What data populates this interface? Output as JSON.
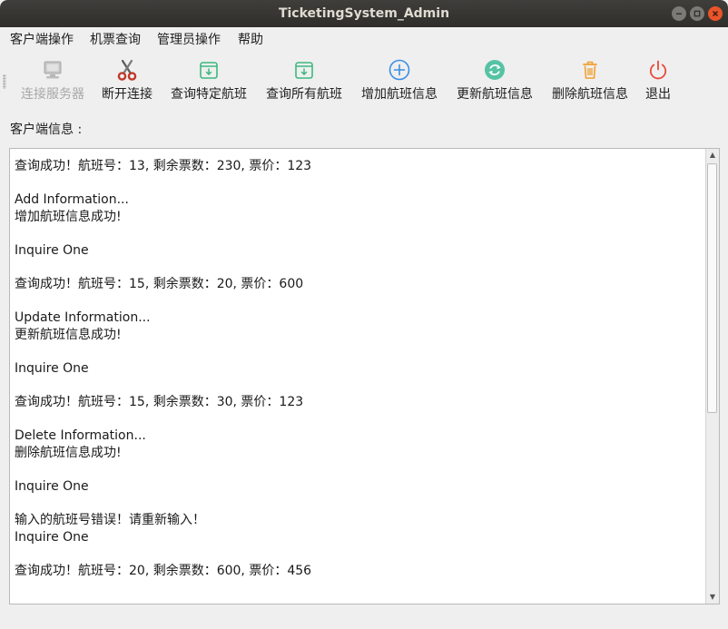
{
  "window": {
    "title": "TicketingSystem_Admin"
  },
  "menubar": {
    "items": [
      {
        "label": "客户端操作"
      },
      {
        "label": "机票查询"
      },
      {
        "label": "管理员操作"
      },
      {
        "label": "帮助"
      }
    ]
  },
  "toolbar": {
    "items": [
      {
        "label": "连接服务器",
        "icon": "server-icon",
        "enabled": false
      },
      {
        "label": "断开连接",
        "icon": "scissors-icon",
        "enabled": true
      },
      {
        "label": "查询特定航班",
        "icon": "archive-down-icon",
        "enabled": true
      },
      {
        "label": "查询所有航班",
        "icon": "archive-down-icon",
        "enabled": true
      },
      {
        "label": "增加航班信息",
        "icon": "add-circle-icon",
        "enabled": true
      },
      {
        "label": "更新航班信息",
        "icon": "refresh-icon",
        "enabled": true
      },
      {
        "label": "删除航班信息",
        "icon": "trash-icon",
        "enabled": true
      },
      {
        "label": "退出",
        "icon": "power-icon",
        "enabled": true
      }
    ]
  },
  "client_info": {
    "label": "客户端信息 :",
    "log": [
      [
        "查询成功！航班号：13, 剩余票数：230, 票价：123"
      ],
      [
        "Add Information...",
        "增加航班信息成功!"
      ],
      [
        "Inquire One"
      ],
      [
        "查询成功！航班号：15, 剩余票数：20, 票价：600"
      ],
      [
        "Update Information...",
        "更新航班信息成功!"
      ],
      [
        "Inquire One"
      ],
      [
        "查询成功！航班号：15, 剩余票数：30, 票价：123"
      ],
      [
        "Delete Information...",
        "删除航班信息成功!"
      ],
      [
        "Inquire One"
      ],
      [
        "输入的航班号错误！请重新输入！",
        "Inquire One"
      ],
      [
        "查询成功！航班号：20, 剩余票数：600, 票价：456"
      ]
    ]
  },
  "colors": {
    "close_button": "#e9542a",
    "titlebar": "#2f2e2b",
    "icon_green": "#3cb87e",
    "icon_blue": "#3a8ee6",
    "icon_orange": "#f0a030",
    "icon_red": "#e84a3a"
  }
}
